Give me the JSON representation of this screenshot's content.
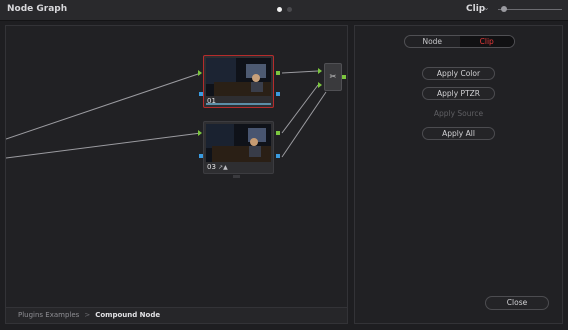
{
  "window": {
    "title": "Node Graph",
    "mode_label": "Clip"
  },
  "graph": {
    "nodes": [
      {
        "label": "01",
        "selected": true
      },
      {
        "label": "03",
        "badge": "↗▲"
      }
    ],
    "mixer_symbol": "✂",
    "breadcrumb": {
      "parent": "Plugins Examples",
      "separator": ">",
      "current": "Compound Node"
    }
  },
  "panel": {
    "tabs": [
      {
        "label": "Node",
        "active": false
      },
      {
        "label": "Clip",
        "active": true
      }
    ],
    "buttons": [
      {
        "label": "Apply Color",
        "enabled": true
      },
      {
        "label": "Apply PTZR",
        "enabled": true
      },
      {
        "label": "Apply Source",
        "enabled": false
      },
      {
        "label": "Apply All",
        "enabled": true
      }
    ],
    "close_label": "Close"
  },
  "colors": {
    "accent": "#e53a3a",
    "selected_border": "#b62c2c",
    "input_port": "#7cc63f",
    "output_port": "#3a9be0"
  }
}
